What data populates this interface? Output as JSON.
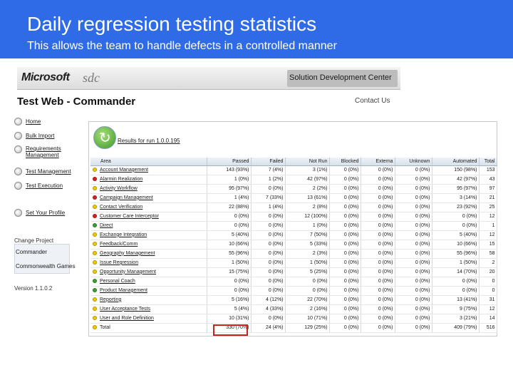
{
  "slide": {
    "title": "Daily regression testing statistics",
    "subtitle": "This allows the team to handle defects in a controlled manner"
  },
  "banner": {
    "logo": "Microsoft",
    "logo_sub": "sdc",
    "center_name": "Solution Development Center"
  },
  "page": {
    "heading": "Test Web - Commander",
    "contact": "Contact Us"
  },
  "sidebar": {
    "items": [
      {
        "label": "Home"
      },
      {
        "label": "Bulk Import"
      },
      {
        "label": "Requirements Management"
      },
      {
        "label": "Test Management"
      },
      {
        "label": "Test Execution"
      },
      {
        "label": "Set Your Profile"
      }
    ],
    "change_project": "Change Project",
    "projects": [
      "Commander",
      "Commonwealth Games"
    ],
    "version": "Version 1.1.0.2"
  },
  "results": {
    "label": "Results for run 1.0.0.195",
    "columns": [
      "Area",
      "Passed",
      "Failed",
      "Not Run",
      "Blocked",
      "Externa",
      "Unknown",
      "Automated",
      "Total"
    ],
    "status_colors": {
      "yellow": "#f0c800",
      "red": "#d62020",
      "green": "#3aa12e"
    },
    "rows": [
      {
        "status": "yellow",
        "area": "Account Management",
        "passed": "143 (93%)",
        "failed": "7 (4%)",
        "notrun": "3 (1%)",
        "blocked": "0 (0%)",
        "external": "0 (0%)",
        "unknown": "0 (0%)",
        "automated": "150 (98%)",
        "total": "153"
      },
      {
        "status": "red",
        "area": "Alarmin Realization",
        "passed": "1 (0%)",
        "failed": "1 (2%)",
        "notrun": "42 (97%)",
        "blocked": "0 (0%)",
        "external": "0 (0%)",
        "unknown": "0 (0%)",
        "automated": "42 (97%)",
        "total": "43"
      },
      {
        "status": "yellow",
        "area": "Activity Workflow",
        "passed": "95 (97%)",
        "failed": "0 (0%)",
        "notrun": "2 (2%)",
        "blocked": "0 (0%)",
        "external": "0 (0%)",
        "unknown": "0 (0%)",
        "automated": "95 (97%)",
        "total": "97"
      },
      {
        "status": "red",
        "area": "Campaign Management",
        "passed": "1 (4%)",
        "failed": "7 (33%)",
        "notrun": "13 (61%)",
        "blocked": "0 (0%)",
        "external": "0 (0%)",
        "unknown": "0 (0%)",
        "automated": "3 (14%)",
        "total": "21"
      },
      {
        "status": "yellow",
        "area": "Contact Verification",
        "passed": "22 (88%)",
        "failed": "1 (4%)",
        "notrun": "2 (8%)",
        "blocked": "0 (0%)",
        "external": "0 (0%)",
        "unknown": "0 (0%)",
        "automated": "23 (92%)",
        "total": "25"
      },
      {
        "status": "red",
        "area": "Customer Care Interceptor",
        "passed": "0 (0%)",
        "failed": "0 (0%)",
        "notrun": "12 (100%)",
        "blocked": "0 (0%)",
        "external": "0 (0%)",
        "unknown": "0 (0%)",
        "automated": "0 (0%)",
        "total": "12"
      },
      {
        "status": "green",
        "area": "Direct",
        "passed": "0 (0%)",
        "failed": "0 (0%)",
        "notrun": "1 (0%)",
        "blocked": "0 (0%)",
        "external": "0 (0%)",
        "unknown": "0 (0%)",
        "automated": "0 (0%)",
        "total": "1"
      },
      {
        "status": "yellow",
        "area": "Exchange Integration",
        "passed": "5 (40%)",
        "failed": "0 (0%)",
        "notrun": "7 (50%)",
        "blocked": "0 (0%)",
        "external": "0 (0%)",
        "unknown": "0 (0%)",
        "automated": "5 (40%)",
        "total": "12"
      },
      {
        "status": "yellow",
        "area": "Feedback/Comm",
        "passed": "10 (66%)",
        "failed": "0 (0%)",
        "notrun": "5 (33%)",
        "blocked": "0 (0%)",
        "external": "0 (0%)",
        "unknown": "0 (0%)",
        "automated": "10 (66%)",
        "total": "15"
      },
      {
        "status": "yellow",
        "area": "Geography Management",
        "passed": "55 (96%)",
        "failed": "0 (0%)",
        "notrun": "2 (3%)",
        "blocked": "0 (0%)",
        "external": "0 (0%)",
        "unknown": "0 (0%)",
        "automated": "55 (96%)",
        "total": "58"
      },
      {
        "status": "yellow",
        "area": "Issue Regression",
        "passed": "1 (50%)",
        "failed": "0 (0%)",
        "notrun": "1 (50%)",
        "blocked": "0 (0%)",
        "external": "0 (0%)",
        "unknown": "0 (0%)",
        "automated": "1 (50%)",
        "total": "2"
      },
      {
        "status": "yellow",
        "area": "Opportunity Management",
        "passed": "15 (75%)",
        "failed": "0 (0%)",
        "notrun": "5 (25%)",
        "blocked": "0 (0%)",
        "external": "0 (0%)",
        "unknown": "0 (0%)",
        "automated": "14 (70%)",
        "total": "20"
      },
      {
        "status": "green",
        "area": "Personal Coach",
        "passed": "0 (0%)",
        "failed": "0 (0%)",
        "notrun": "0 (0%)",
        "blocked": "0 (0%)",
        "external": "0 (0%)",
        "unknown": "0 (0%)",
        "automated": "0 (0%)",
        "total": "0"
      },
      {
        "status": "green",
        "area": "Product Management",
        "passed": "0 (0%)",
        "failed": "0 (0%)",
        "notrun": "0 (0%)",
        "blocked": "0 (0%)",
        "external": "0 (0%)",
        "unknown": "0 (0%)",
        "automated": "0 (0%)",
        "total": "0"
      },
      {
        "status": "yellow",
        "area": "Reporting",
        "passed": "5 (16%)",
        "failed": "4 (12%)",
        "notrun": "22 (70%)",
        "blocked": "0 (0%)",
        "external": "0 (0%)",
        "unknown": "0 (0%)",
        "automated": "13 (41%)",
        "total": "31"
      },
      {
        "status": "yellow",
        "area": "User Acceptance Tests",
        "passed": "5 (4%)",
        "failed": "4 (33%)",
        "notrun": "2 (16%)",
        "blocked": "0 (0%)",
        "external": "0 (0%)",
        "unknown": "0 (0%)",
        "automated": "9 (75%)",
        "total": "12"
      },
      {
        "status": "yellow",
        "area": "User and Role Definition",
        "passed": "10 (31%)",
        "failed": "0 (0%)",
        "notrun": "10 (71%)",
        "blocked": "0 (0%)",
        "external": "0 (0%)",
        "unknown": "0 (0%)",
        "automated": "3 (21%)",
        "total": "14"
      },
      {
        "status": "yellow",
        "area": "Total",
        "passed": "330 (70%)",
        "failed": "24 (4%)",
        "notrun": "129 (25%)",
        "blocked": "0 (0%)",
        "external": "0 (0%)",
        "unknown": "0 (0%)",
        "automated": "409 (79%)",
        "total": "516"
      }
    ]
  }
}
